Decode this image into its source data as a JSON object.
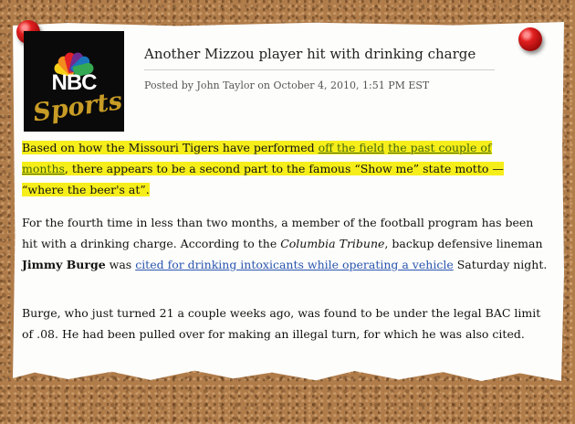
{
  "post": {
    "logo": {
      "network": "NBC",
      "brand": "Sports",
      "feather_colors": [
        "#f7d117",
        "#f28b1e",
        "#e32026",
        "#6e2c91",
        "#1b75bb",
        "#34a853"
      ]
    },
    "headline": "Another Mizzou player hit with drinking charge",
    "byline": "Posted by John Taylor on October 4, 2010, 1:51 PM EST",
    "paragraph1": {
      "t1": "Based on how the Missouri Tigers have performed ",
      "link1": "off the field",
      "t2": " ",
      "link2": "the past couple of months",
      "t3": ", there appears to be a second part to the famous “Show me” state motto — “where the beer's at”."
    },
    "paragraph2": {
      "t1": "For the fourth time in less than two months, a member of the football program has been hit with a drinking charge.  According to the ",
      "em": "Columbia Tribune",
      "t2": ", backup defensive lineman ",
      "bold": "Jimmy Burge",
      "t3": " was ",
      "link": "cited for drinking intoxicants while operating a vehicle",
      "t4": " Saturday night."
    },
    "paragraph3": "Burge, who just turned 21 a couple weeks ago, was found to be under the legal BAC limit of .08. He had been pulled over for making an illegal turn, for which he was also cited."
  },
  "colors": {
    "highlight": "#f6ee1a",
    "link": "#2a55b0",
    "cork": "#b07c4a",
    "pin": "#d91c1c"
  }
}
